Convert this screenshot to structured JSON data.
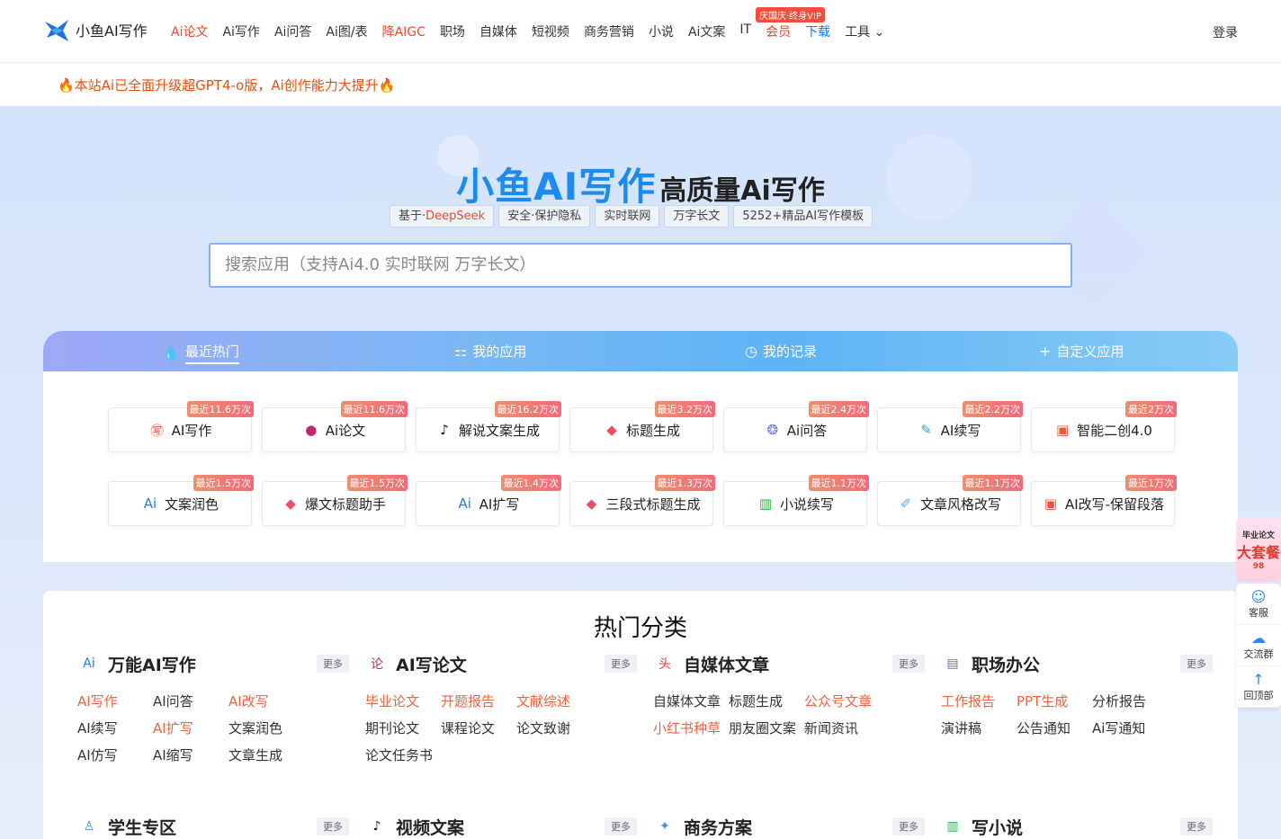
{
  "header": {
    "logo_text": "小鱼AI写作",
    "nav": [
      {
        "label": "Ai论文",
        "style": "red"
      },
      {
        "label": "Ai写作",
        "style": ""
      },
      {
        "label": "Ai问答",
        "style": ""
      },
      {
        "label": "Ai图/表",
        "style": ""
      },
      {
        "label": "降AIGC",
        "style": "red"
      },
      {
        "label": "职场",
        "style": ""
      },
      {
        "label": "自媒体",
        "style": ""
      },
      {
        "label": "短视频",
        "style": ""
      },
      {
        "label": "商务营销",
        "style": ""
      },
      {
        "label": "小说",
        "style": ""
      },
      {
        "label": "Ai文案",
        "style": ""
      },
      {
        "label": "IT",
        "style": ""
      },
      {
        "label": "会员",
        "style": "red"
      },
      {
        "label": "下载",
        "style": "blue"
      },
      {
        "label": "工具 ⌄",
        "style": ""
      }
    ],
    "vip_badge": "庆国庆·终身VIP",
    "login": "登录"
  },
  "notice": "🔥本站Ai已全面升级超GPT4-o版，Ai创作能力大提升🔥",
  "hero": {
    "title_main": "小鱼AI写作",
    "title_sub": "高质量Ai写作",
    "tags": [
      {
        "pre": "基于·",
        "hl": "DeepSeek"
      },
      {
        "pre": "安全·保护隐私",
        "hl": ""
      },
      {
        "pre": "实时联网",
        "hl": ""
      },
      {
        "pre": "万字长文",
        "hl": ""
      },
      {
        "pre": "5252+精品AI写作模板",
        "hl": ""
      }
    ],
    "search_placeholder": "搜索应用（支持Ai4.0 实时联网 万字长文）"
  },
  "tabs": [
    {
      "label": "最近热门",
      "icon": "flame-icon",
      "glyph": "💧"
    },
    {
      "label": "我的应用",
      "icon": "grid-icon",
      "glyph": "⚏"
    },
    {
      "label": "我的记录",
      "icon": "clock-icon",
      "glyph": "◷"
    },
    {
      "label": "自定义应用",
      "icon": "plus-icon",
      "glyph": "+"
    }
  ],
  "apps": [
    {
      "label": "AI写作",
      "badge": "最近11.6万次",
      "icon": "write-icon",
      "glyph": "㊢",
      "color": "#e8553c"
    },
    {
      "label": "Ai论文",
      "badge": "最近11.6万次",
      "icon": "paper-icon",
      "glyph": "●",
      "color": "#c2296a"
    },
    {
      "label": "解说文案生成",
      "badge": "最近16.2万次",
      "icon": "tiktok-icon",
      "glyph": "♪",
      "color": "#111"
    },
    {
      "label": "标题生成",
      "badge": "最近3.2万次",
      "icon": "tag-icon",
      "glyph": "◆",
      "color": "#ee4b62"
    },
    {
      "label": "Ai问答",
      "badge": "最近2.4万次",
      "icon": "chat-icon",
      "glyph": "❂",
      "color": "#6b74e8"
    },
    {
      "label": "AI续写",
      "badge": "最近2.2万次",
      "icon": "pen-icon",
      "glyph": "✎",
      "color": "#27a2d6"
    },
    {
      "label": "智能二创4.0",
      "badge": "最近2万次",
      "icon": "rewrite-icon",
      "glyph": "▣",
      "color": "#e8553c"
    },
    {
      "label": "文案润色",
      "badge": "最近1.5万次",
      "icon": "ai-icon",
      "glyph": "Ai",
      "color": "#1f7fe4"
    },
    {
      "label": "爆文标题助手",
      "badge": "最近1.5万次",
      "icon": "tag-icon",
      "glyph": "◆",
      "color": "#ee4b62"
    },
    {
      "label": "AI扩写",
      "badge": "最近1.4万次",
      "icon": "ai-icon",
      "glyph": "Ai",
      "color": "#1f7fe4"
    },
    {
      "label": "三段式标题生成",
      "badge": "最近1.3万次",
      "icon": "tag-icon",
      "glyph": "◆",
      "color": "#ee4b62"
    },
    {
      "label": "小说续写",
      "badge": "最近1.1万次",
      "icon": "book-icon",
      "glyph": "▥",
      "color": "#2fae4a"
    },
    {
      "label": "文章风格改写",
      "badge": "最近1.1万次",
      "icon": "edit-icon",
      "glyph": "✐",
      "color": "#5ba8e8"
    },
    {
      "label": "AI改写-保留段落",
      "badge": "最近1万次",
      "icon": "rewrite-icon",
      "glyph": "▣",
      "color": "#e8553c"
    }
  ],
  "categories_title": "热门分类",
  "categories": [
    {
      "name": "万能AI写作",
      "icon": "ai-icon",
      "glyph": "Ai",
      "color": "#1f7fe4",
      "more": "更多",
      "links": [
        {
          "t": "AI写作",
          "red": true
        },
        {
          "t": "AI问答",
          "red": false
        },
        {
          "t": "AI改写",
          "red": true
        },
        {
          "t": "AI续写",
          "red": false
        },
        {
          "t": "AI扩写",
          "red": true
        },
        {
          "t": "文案润色",
          "red": false
        },
        {
          "t": "AI仿写",
          "red": false
        },
        {
          "t": "AI缩写",
          "red": false
        },
        {
          "t": "文章生成",
          "red": false
        }
      ]
    },
    {
      "name": "AI写论文",
      "icon": "paper-icon",
      "glyph": "论",
      "color": "#c2296a",
      "more": "更多",
      "links": [
        {
          "t": "毕业论文",
          "red": true
        },
        {
          "t": "开题报告",
          "red": true
        },
        {
          "t": "文献综述",
          "red": true
        },
        {
          "t": "期刊论文",
          "red": false
        },
        {
          "t": "课程论文",
          "red": false
        },
        {
          "t": "论文致谢",
          "red": false
        },
        {
          "t": "论文任务书",
          "red": false
        }
      ]
    },
    {
      "name": "自媒体文章",
      "icon": "media-icon",
      "glyph": "头",
      "color": "#e53c2e",
      "more": "更多",
      "links": [
        {
          "t": "自媒体文章",
          "red": false
        },
        {
          "t": "标题生成",
          "red": false
        },
        {
          "t": "公众号文章",
          "red": true
        },
        {
          "t": "小红书种草",
          "red": true
        },
        {
          "t": "朋友圈文案",
          "red": false
        },
        {
          "t": "新闻资讯",
          "red": false
        }
      ]
    },
    {
      "name": "职场办公",
      "icon": "briefcase-icon",
      "glyph": "▤",
      "color": "#5a6ee8",
      "more": "更多",
      "links": [
        {
          "t": "工作报告",
          "red": true
        },
        {
          "t": "PPT生成",
          "red": true
        },
        {
          "t": "分析报告",
          "red": false
        },
        {
          "t": "演讲稿",
          "red": false
        },
        {
          "t": "公告通知",
          "red": false
        },
        {
          "t": "Ai写通知",
          "red": false
        }
      ]
    },
    {
      "name": "学生专区",
      "icon": "student-icon",
      "glyph": "♙",
      "color": "#4a8fe8",
      "more": "更多",
      "links": []
    },
    {
      "name": "视频文案",
      "icon": "tiktok-icon",
      "glyph": "♪",
      "color": "#111",
      "more": "更多",
      "links": []
    },
    {
      "name": "商务方案",
      "icon": "business-icon",
      "glyph": "✦",
      "color": "#4a8fe8",
      "more": "更多",
      "links": []
    },
    {
      "name": "写小说",
      "icon": "book-icon",
      "glyph": "▥",
      "color": "#2fae4a",
      "more": "更多",
      "links": []
    }
  ],
  "float": {
    "promo_top": "毕业论文",
    "promo_big": "大套餐",
    "promo_num": "98",
    "buttons": [
      {
        "label": "客服",
        "icon": "service-icon",
        "glyph": "☺"
      },
      {
        "label": "交流群",
        "icon": "wechat-icon",
        "glyph": "☁"
      },
      {
        "label": "回顶部",
        "icon": "arrow-up-icon",
        "glyph": "↑"
      }
    ]
  }
}
